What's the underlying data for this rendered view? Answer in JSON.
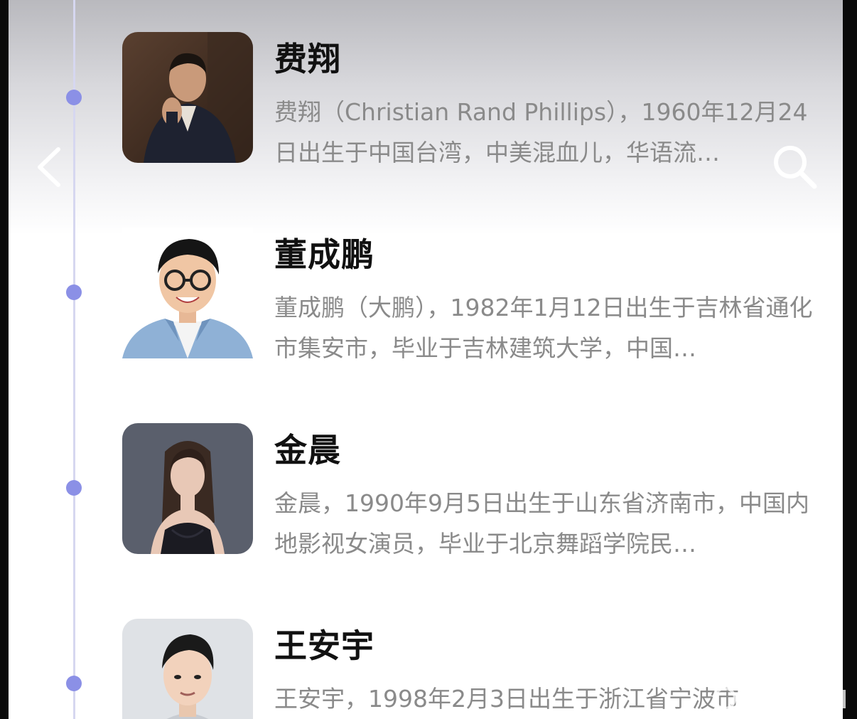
{
  "navigation": {
    "back_icon": "chevron-left-icon",
    "search_icon": "search-icon"
  },
  "colors": {
    "timeline_dot": "#8b90e6",
    "timeline_line": "#d6d7f0",
    "name_text": "#111111",
    "desc_text": "#8a8a8a"
  },
  "people": [
    {
      "name": "费翔",
      "desc": "费翔（Christian Rand Phillips），1960年12月24日出生于中国台湾，中美混血儿，华语流…",
      "avatar": "portrait-man-dark-suit"
    },
    {
      "name": "董成鹏",
      "desc": "董成鹏（大鹏），1982年1月12日出生于吉林省通化市集安市，毕业于吉林建筑大学，中国…",
      "avatar": "portrait-man-glasses-denim-shirt"
    },
    {
      "name": "金晨",
      "desc": "金晨，1990年9月5日出生于山东省济南市，中国内地影视女演员，毕业于北京舞蹈学院民…",
      "avatar": "portrait-woman-black-dress"
    },
    {
      "name": "王安宇",
      "desc": "王安宇，1998年2月3日出生于浙江省宁波市",
      "avatar": "portrait-young-man"
    }
  ]
}
